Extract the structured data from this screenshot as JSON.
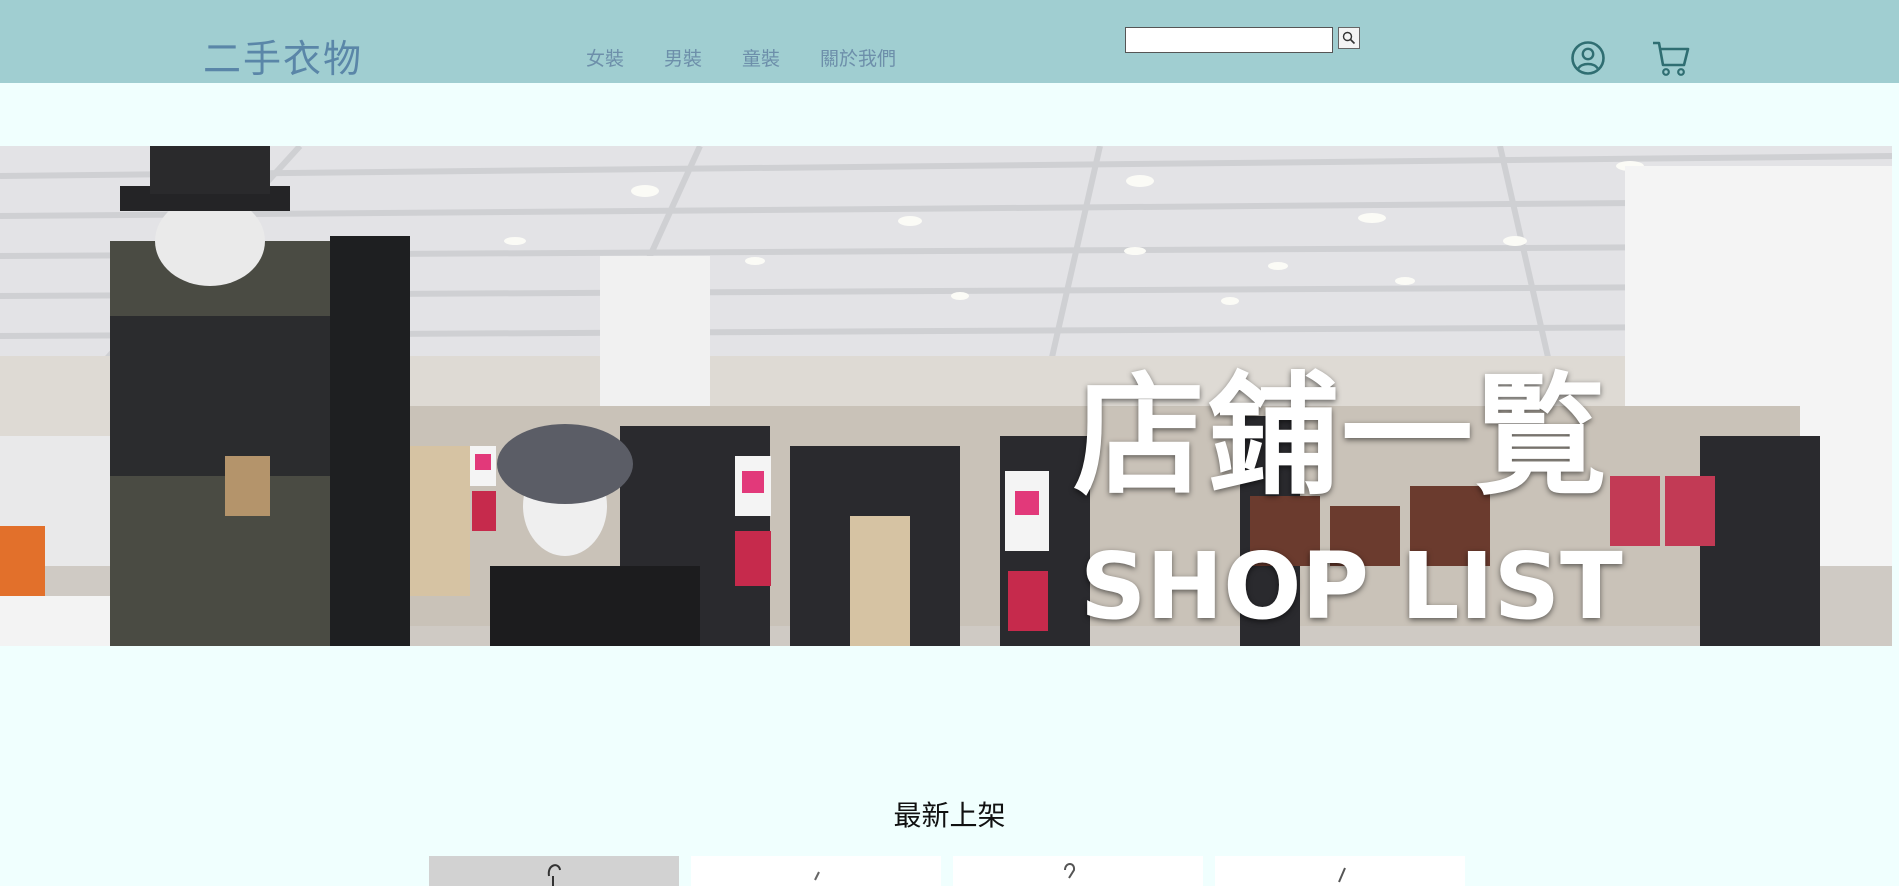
{
  "header": {
    "logo": "二手衣物",
    "nav": [
      "女裝",
      "男裝",
      "童裝",
      "關於我們"
    ],
    "search": {
      "placeholder": "",
      "value": ""
    }
  },
  "icons": {
    "search_button": "search-icon",
    "account": "user-circle-icon",
    "cart": "shopping-cart-icon"
  },
  "banner": {
    "title": "店鋪一覧",
    "subtitle": "SHOP LIST"
  },
  "latest": {
    "title": "最新上架",
    "products": [
      {},
      {},
      {},
      {}
    ]
  },
  "colors": {
    "header_bg": "#a0ced1",
    "page_bg": "#f0fffe",
    "logo": "#5a86a8",
    "nav_text": "#6d8faa",
    "icon": "#2f6e72"
  }
}
